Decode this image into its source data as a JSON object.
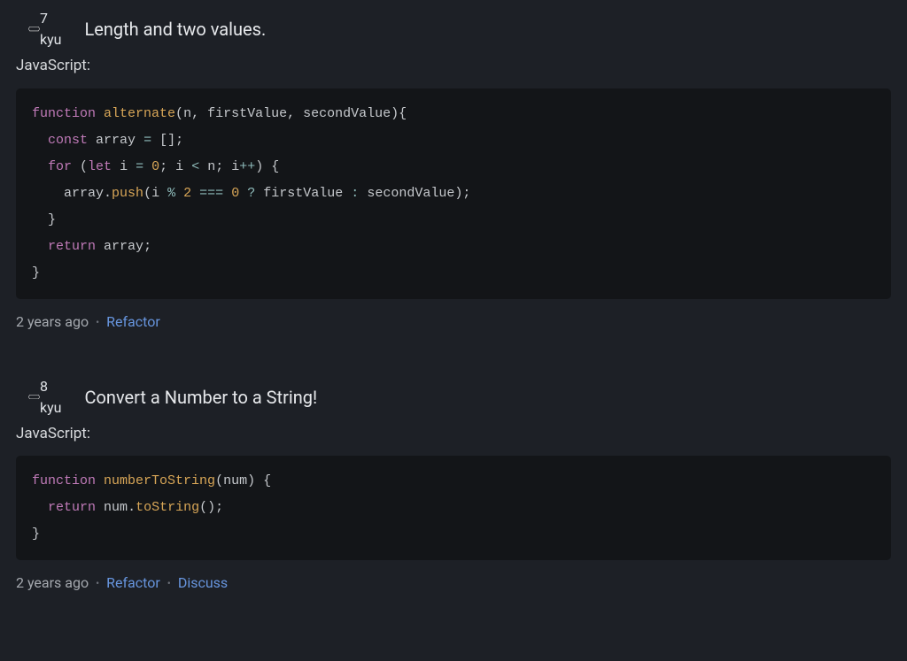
{
  "entries": [
    {
      "kyu": "7 kyu",
      "title": "Length and two values.",
      "language": "JavaScript:",
      "timestamp": "2 years ago",
      "links": [
        "Refactor"
      ],
      "code_tokens": [
        [
          [
            "k",
            "function"
          ],
          [
            "p",
            " "
          ],
          [
            "fn",
            "alternate"
          ],
          [
            "p",
            "("
          ],
          [
            "v",
            "n"
          ],
          [
            "p",
            ", "
          ],
          [
            "v",
            "firstValue"
          ],
          [
            "p",
            ", "
          ],
          [
            "v",
            "secondValue"
          ],
          [
            "p",
            "){"
          ]
        ],
        [
          [
            "p",
            "  "
          ],
          [
            "k",
            "const"
          ],
          [
            "p",
            " "
          ],
          [
            "v",
            "array"
          ],
          [
            "p",
            " "
          ],
          [
            "o",
            "="
          ],
          [
            "p",
            " [];"
          ]
        ],
        [
          [
            "p",
            "  "
          ],
          [
            "k",
            "for"
          ],
          [
            "p",
            " ("
          ],
          [
            "k",
            "let"
          ],
          [
            "p",
            " "
          ],
          [
            "v",
            "i"
          ],
          [
            "p",
            " "
          ],
          [
            "o",
            "="
          ],
          [
            "p",
            " "
          ],
          [
            "n",
            "0"
          ],
          [
            "p",
            "; "
          ],
          [
            "v",
            "i"
          ],
          [
            "p",
            " "
          ],
          [
            "o",
            "<"
          ],
          [
            "p",
            " "
          ],
          [
            "v",
            "n"
          ],
          [
            "p",
            "; "
          ],
          [
            "v",
            "i"
          ],
          [
            "o",
            "++"
          ],
          [
            "p",
            ") {"
          ]
        ],
        [
          [
            "p",
            "    "
          ],
          [
            "v",
            "array"
          ],
          [
            "p",
            "."
          ],
          [
            "fn",
            "push"
          ],
          [
            "p",
            "("
          ],
          [
            "v",
            "i"
          ],
          [
            "p",
            " "
          ],
          [
            "o",
            "%"
          ],
          [
            "p",
            " "
          ],
          [
            "n",
            "2"
          ],
          [
            "p",
            " "
          ],
          [
            "o",
            "==="
          ],
          [
            "p",
            " "
          ],
          [
            "n",
            "0"
          ],
          [
            "p",
            " "
          ],
          [
            "o",
            "?"
          ],
          [
            "p",
            " "
          ],
          [
            "v",
            "firstValue"
          ],
          [
            "p",
            " "
          ],
          [
            "o",
            ":"
          ],
          [
            "p",
            " "
          ],
          [
            "v",
            "secondValue"
          ],
          [
            "p",
            ");"
          ]
        ],
        [
          [
            "p",
            "  }"
          ]
        ],
        [
          [
            "p",
            "  "
          ],
          [
            "k",
            "return"
          ],
          [
            "p",
            " "
          ],
          [
            "v",
            "array"
          ],
          [
            "p",
            ";"
          ]
        ],
        [
          [
            "p",
            "}"
          ]
        ]
      ]
    },
    {
      "kyu": "8 kyu",
      "title": "Convert a Number to a String!",
      "language": "JavaScript:",
      "timestamp": "2 years ago",
      "links": [
        "Refactor",
        "Discuss"
      ],
      "code_tokens": [
        [
          [
            "k",
            "function"
          ],
          [
            "p",
            " "
          ],
          [
            "fn",
            "numberToString"
          ],
          [
            "p",
            "("
          ],
          [
            "v",
            "num"
          ],
          [
            "p",
            ") {"
          ]
        ],
        [
          [
            "p",
            "  "
          ],
          [
            "k",
            "return"
          ],
          [
            "p",
            " "
          ],
          [
            "v",
            "num"
          ],
          [
            "p",
            "."
          ],
          [
            "fn",
            "toString"
          ],
          [
            "p",
            "();"
          ]
        ],
        [
          [
            "p",
            "}"
          ]
        ]
      ]
    }
  ],
  "dot": "•"
}
